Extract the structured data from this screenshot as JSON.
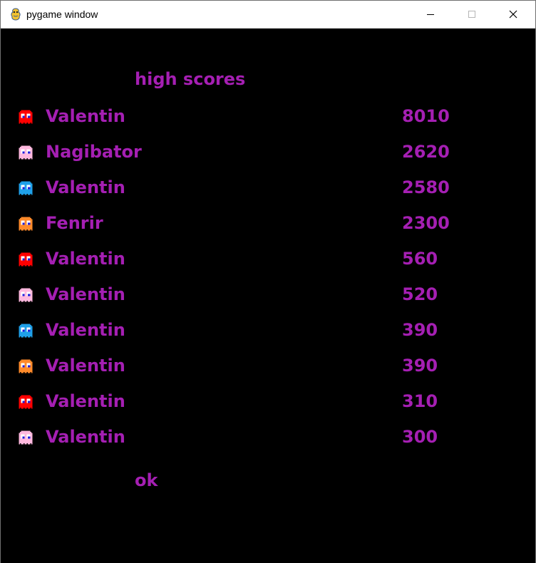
{
  "window": {
    "title": "pygame window",
    "icon": "pygame-snake-icon"
  },
  "screen": {
    "heading": "high scores",
    "text_color": "#a51fb3",
    "background_color": "#000000",
    "ok_label": "ok"
  },
  "scores": [
    {
      "name": "Valentin",
      "score": "8010",
      "ghost": "red-ghost-icon",
      "ghost_color": "#ff0000"
    },
    {
      "name": "Nagibator",
      "score": "2620",
      "ghost": "pink-ghost-icon",
      "ghost_color": "#ffb8de"
    },
    {
      "name": "Valentin",
      "score": "2580",
      "ghost": "cyan-ghost-icon",
      "ghost_color": "#1fa0e8"
    },
    {
      "name": "Fenrir",
      "score": "2300",
      "ghost": "orange-ghost-icon",
      "ghost_color": "#ff8a2a"
    },
    {
      "name": "Valentin",
      "score": "560",
      "ghost": "red-ghost-icon",
      "ghost_color": "#ff0000"
    },
    {
      "name": "Valentin",
      "score": "520",
      "ghost": "pink-ghost-icon",
      "ghost_color": "#ffb8de"
    },
    {
      "name": "Valentin",
      "score": "390",
      "ghost": "cyan-ghost-icon",
      "ghost_color": "#1fa0e8"
    },
    {
      "name": "Valentin",
      "score": "390",
      "ghost": "orange-ghost-icon",
      "ghost_color": "#ff8a2a"
    },
    {
      "name": "Valentin",
      "score": "310",
      "ghost": "red-ghost-icon",
      "ghost_color": "#ff0000"
    },
    {
      "name": "Valentin",
      "score": "300",
      "ghost": "pink-ghost-icon",
      "ghost_color": "#ffb8de"
    }
  ]
}
